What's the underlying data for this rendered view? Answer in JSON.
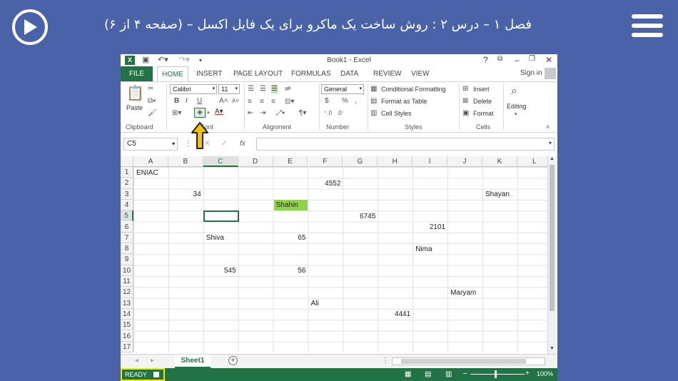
{
  "page": {
    "title": "فصل ۱ – درس ۲ : روش ساخت یک ماکرو برای یک فایل اکسل – (صفحه ۴ از ۶)"
  },
  "excel": {
    "window_title": "Book1 - Excel",
    "help": "?",
    "file_tab": "FILE",
    "tabs": [
      "HOME",
      "INSERT",
      "PAGE LAYOUT",
      "FORMULAS",
      "DATA",
      "REVIEW",
      "VIEW"
    ],
    "active_tab": "HOME",
    "sign_in": "Sign in",
    "ribbon": {
      "clipboard": {
        "label": "Clipboard",
        "paste": "Paste"
      },
      "font": {
        "label": "Font",
        "name": "Calibri",
        "size": "11",
        "bold": "B",
        "italic": "I",
        "underline": "U"
      },
      "alignment": {
        "label": "Alignment"
      },
      "number": {
        "label": "Number",
        "format": "General",
        "currency": "$",
        "percent": "%"
      },
      "styles": {
        "label": "Styles",
        "conditional": "Conditional Formatting",
        "table": "Format as Table",
        "cell_styles": "Cell Styles"
      },
      "cells": {
        "label": "Cells",
        "insert": "Insert",
        "delete": "Delete",
        "format": "Format"
      },
      "editing": {
        "label": "Editing"
      }
    },
    "formula_bar": {
      "name_box": "C5",
      "fx": "fx",
      "value": ""
    },
    "columns": [
      "A",
      "B",
      "C",
      "D",
      "E",
      "F",
      "G",
      "H",
      "I",
      "J",
      "K",
      "L"
    ],
    "selected_column": "C",
    "rows": [
      "1",
      "2",
      "3",
      "4",
      "5",
      "6",
      "7",
      "8",
      "9",
      "10",
      "11",
      "12",
      "13",
      "14",
      "15",
      "16",
      "17"
    ],
    "selected_row": "5",
    "cells": [
      {
        "col": 0,
        "row": 0,
        "value": "ENIAC",
        "num": false
      },
      {
        "col": 5,
        "row": 1,
        "value": "4552",
        "num": true
      },
      {
        "col": 1,
        "row": 2,
        "value": "34",
        "num": true
      },
      {
        "col": 10,
        "row": 2,
        "value": "Shayan",
        "num": false
      },
      {
        "col": 4,
        "row": 3,
        "value": "Shahin",
        "num": false,
        "fill": "#92d050"
      },
      {
        "col": 6,
        "row": 4,
        "value": "6745",
        "num": true
      },
      {
        "col": 8,
        "row": 5,
        "value": "2101",
        "num": true
      },
      {
        "col": 2,
        "row": 6,
        "value": "Shiva",
        "num": false
      },
      {
        "col": 4,
        "row": 6,
        "value": "65",
        "num": true
      },
      {
        "col": 8,
        "row": 7,
        "value": "Nima",
        "num": false
      },
      {
        "col": 2,
        "row": 9,
        "value": "545",
        "num": true
      },
      {
        "col": 4,
        "row": 9,
        "value": "56",
        "num": true
      },
      {
        "col": 9,
        "row": 11,
        "value": "Maryam",
        "num": false
      },
      {
        "col": 5,
        "row": 12,
        "value": "Ali",
        "num": false
      },
      {
        "col": 7,
        "row": 13,
        "value": "4441",
        "num": true
      }
    ],
    "sheet_tab": "Sheet1",
    "status": "READY",
    "zoom": "100%",
    "colors": {
      "excel_green": "#217346",
      "highlight": "#f5e600",
      "header_blue": "#4a62a8"
    }
  }
}
